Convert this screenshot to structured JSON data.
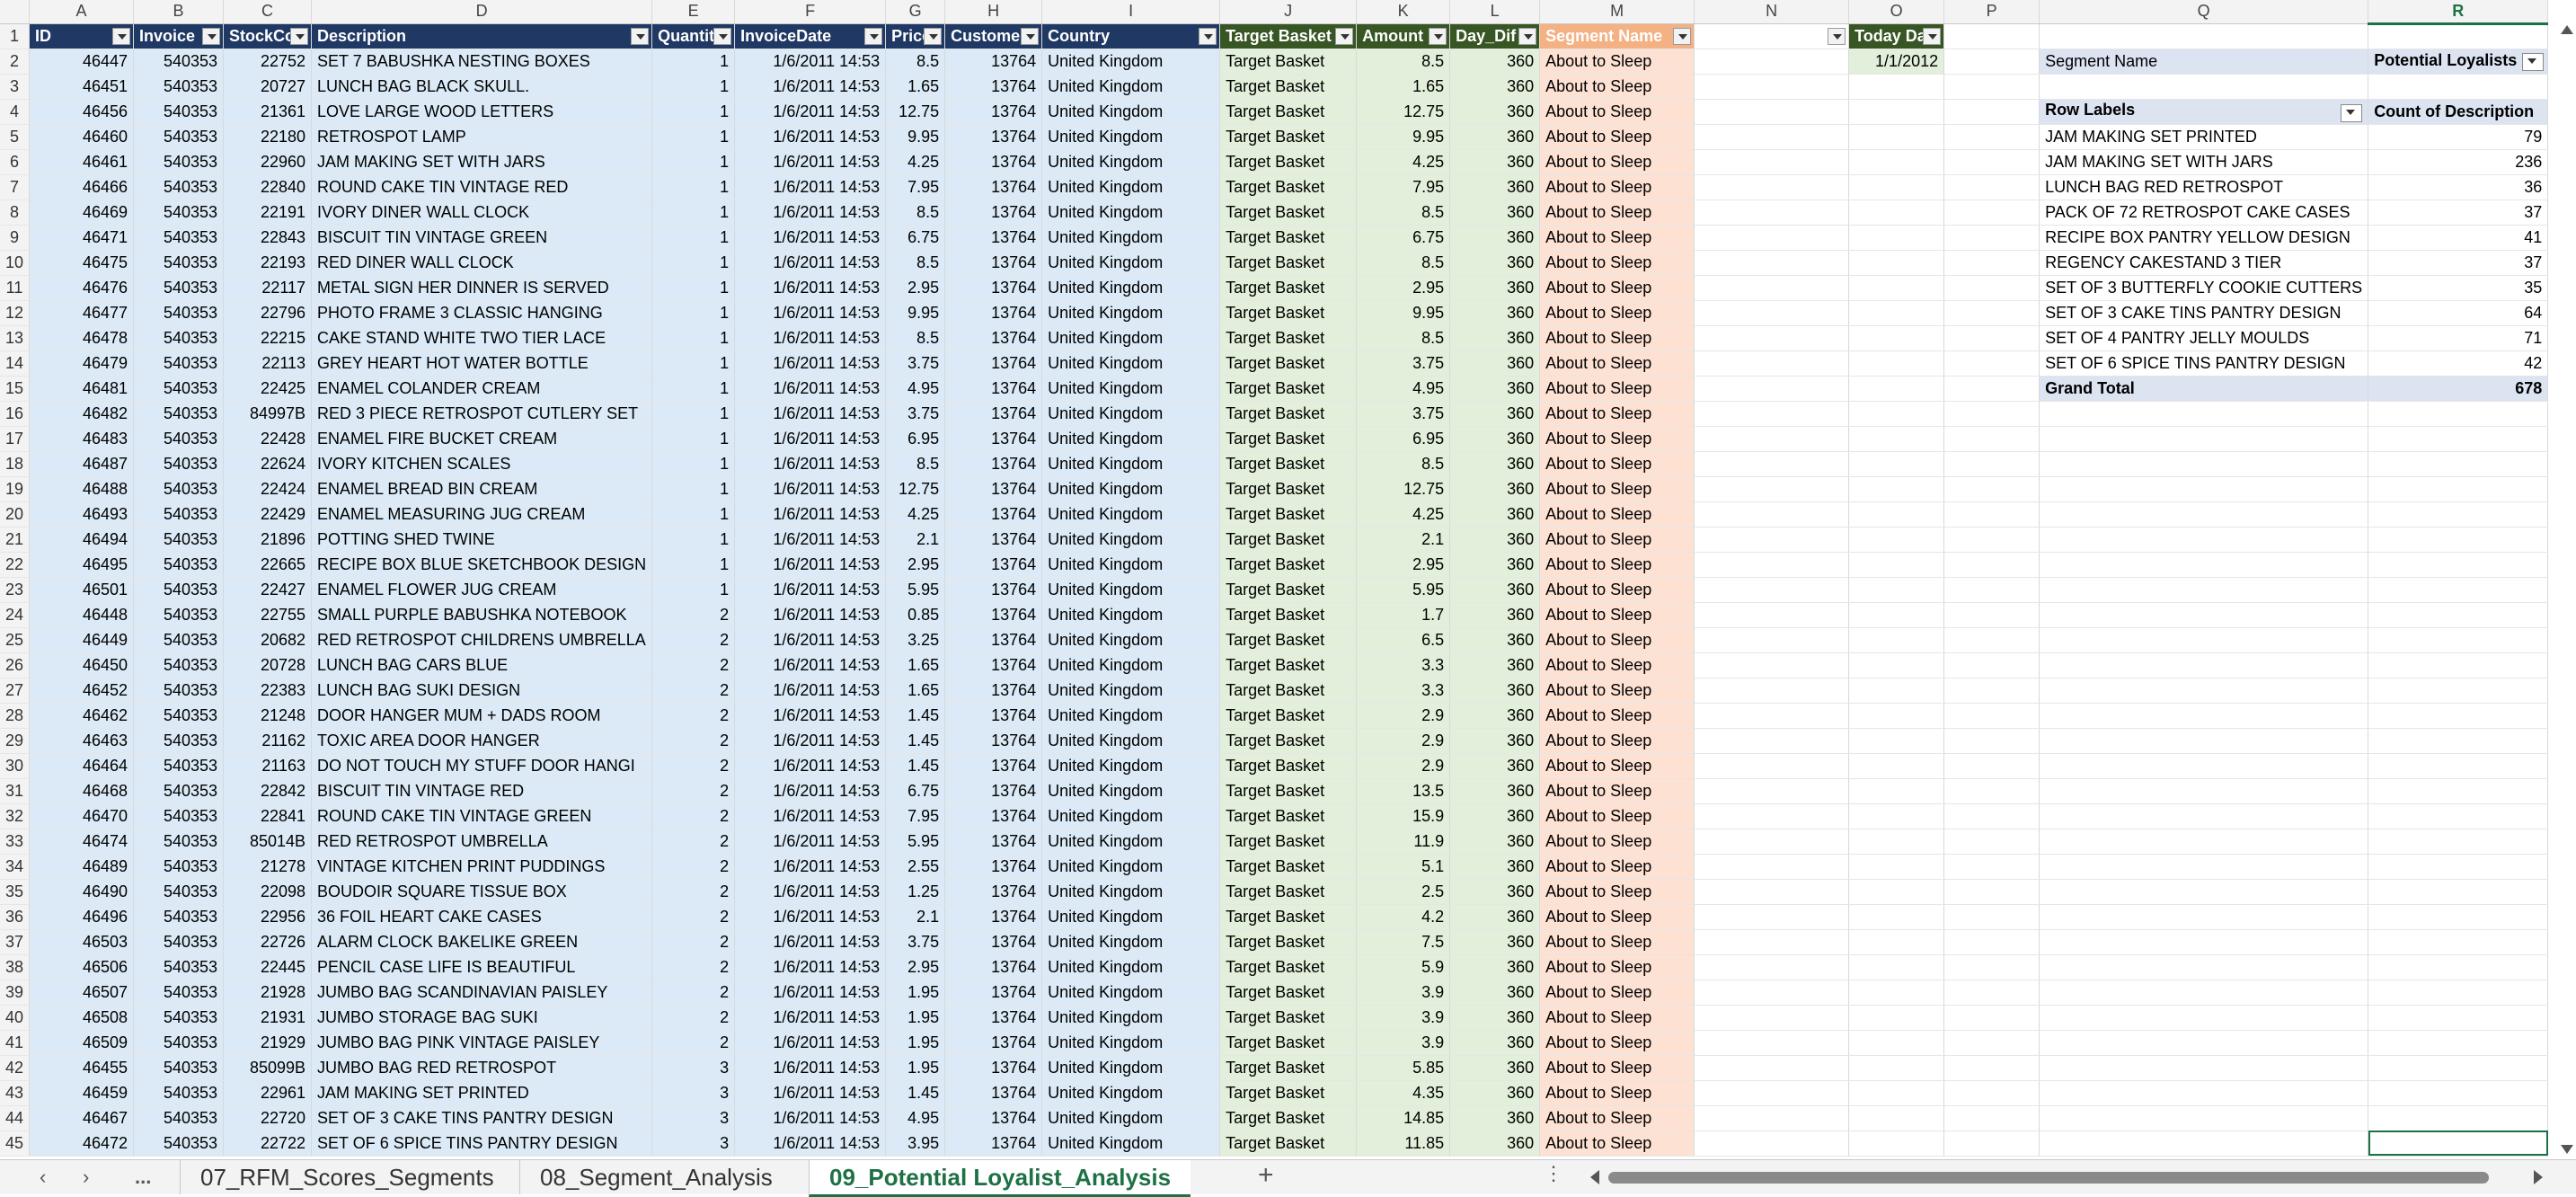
{
  "app": {
    "sheet_tabs": [
      "07_RFM_Scores_Segments",
      "08_Segment_Analysis",
      "09_Potential Loyalist_Analysis"
    ],
    "active_tab": "09_Potential Loyalist_Analysis",
    "more_tabs_label": "...",
    "add_sheet_label": "+",
    "selected_column": "R"
  },
  "column_letters": [
    "A",
    "B",
    "C",
    "D",
    "E",
    "F",
    "G",
    "H",
    "I",
    "J",
    "K",
    "L",
    "M",
    "N",
    "O",
    "P",
    "Q",
    "R"
  ],
  "headers": {
    "id": "ID",
    "invoice": "Invoice",
    "stockcode": "StockCo",
    "description": "Description",
    "quantity": "Quantit",
    "invoicedate": "InvoiceDate",
    "price": "Price",
    "customer": "Customer",
    "country": "Country",
    "target": "Target Basket",
    "amount": "Amount",
    "daydiff": "Day_Dif",
    "segment": "Segment Name",
    "today": "Today Da"
  },
  "today_value": "1/1/2012",
  "constants": {
    "invoice_date": "1/6/2011 14:53",
    "customer": "13764",
    "country": "United Kingdom",
    "target": "Target Basket",
    "day_diff": "360",
    "segment": "About to Sleep"
  },
  "rows": [
    [
      "46447",
      "540353",
      "22752",
      "SET 7 BABUSHKA NESTING BOXES",
      "1",
      "8.5",
      "8.5"
    ],
    [
      "46451",
      "540353",
      "20727",
      "LUNCH BAG  BLACK SKULL.",
      "1",
      "1.65",
      "1.65"
    ],
    [
      "46456",
      "540353",
      "21361",
      "LOVE LARGE WOOD LETTERS",
      "1",
      "12.75",
      "12.75"
    ],
    [
      "46460",
      "540353",
      "22180",
      "RETROSPOT LAMP",
      "1",
      "9.95",
      "9.95"
    ],
    [
      "46461",
      "540353",
      "22960",
      "JAM MAKING SET WITH JARS",
      "1",
      "4.25",
      "4.25"
    ],
    [
      "46466",
      "540353",
      "22840",
      "ROUND CAKE TIN VINTAGE RED",
      "1",
      "7.95",
      "7.95"
    ],
    [
      "46469",
      "540353",
      "22191",
      "IVORY DINER WALL CLOCK",
      "1",
      "8.5",
      "8.5"
    ],
    [
      "46471",
      "540353",
      "22843",
      "BISCUIT TIN VINTAGE GREEN",
      "1",
      "6.75",
      "6.75"
    ],
    [
      "46475",
      "540353",
      "22193",
      "RED DINER WALL CLOCK",
      "1",
      "8.5",
      "8.5"
    ],
    [
      "46476",
      "540353",
      "22117",
      "METAL SIGN HER DINNER IS SERVED",
      "1",
      "2.95",
      "2.95"
    ],
    [
      "46477",
      "540353",
      "22796",
      "PHOTO FRAME 3 CLASSIC HANGING",
      "1",
      "9.95",
      "9.95"
    ],
    [
      "46478",
      "540353",
      "22215",
      "CAKE STAND WHITE TWO TIER LACE",
      "1",
      "8.5",
      "8.5"
    ],
    [
      "46479",
      "540353",
      "22113",
      "GREY HEART HOT WATER BOTTLE",
      "1",
      "3.75",
      "3.75"
    ],
    [
      "46481",
      "540353",
      "22425",
      "ENAMEL COLANDER CREAM",
      "1",
      "4.95",
      "4.95"
    ],
    [
      "46482",
      "540353",
      "84997B",
      "RED 3 PIECE RETROSPOT CUTLERY SET",
      "1",
      "3.75",
      "3.75"
    ],
    [
      "46483",
      "540353",
      "22428",
      "ENAMEL FIRE BUCKET CREAM",
      "1",
      "6.95",
      "6.95"
    ],
    [
      "46487",
      "540353",
      "22624",
      "IVORY KITCHEN SCALES",
      "1",
      "8.5",
      "8.5"
    ],
    [
      "46488",
      "540353",
      "22424",
      "ENAMEL BREAD BIN CREAM",
      "1",
      "12.75",
      "12.75"
    ],
    [
      "46493",
      "540353",
      "22429",
      "ENAMEL MEASURING JUG CREAM",
      "1",
      "4.25",
      "4.25"
    ],
    [
      "46494",
      "540353",
      "21896",
      "POTTING SHED TWINE",
      "1",
      "2.1",
      "2.1"
    ],
    [
      "46495",
      "540353",
      "22665",
      "RECIPE BOX BLUE SKETCHBOOK DESIGN",
      "1",
      "2.95",
      "2.95"
    ],
    [
      "46501",
      "540353",
      "22427",
      "ENAMEL FLOWER JUG CREAM",
      "1",
      "5.95",
      "5.95"
    ],
    [
      "46448",
      "540353",
      "22755",
      "SMALL PURPLE BABUSHKA NOTEBOOK",
      "2",
      "0.85",
      "1.7"
    ],
    [
      "46449",
      "540353",
      "20682",
      "RED RETROSPOT CHILDRENS UMBRELLA",
      "2",
      "3.25",
      "6.5"
    ],
    [
      "46450",
      "540353",
      "20728",
      "LUNCH BAG CARS BLUE",
      "2",
      "1.65",
      "3.3"
    ],
    [
      "46452",
      "540353",
      "22383",
      "LUNCH BAG SUKI  DESIGN",
      "2",
      "1.65",
      "3.3"
    ],
    [
      "46462",
      "540353",
      "21248",
      "DOOR HANGER  MUM + DADS ROOM",
      "2",
      "1.45",
      "2.9"
    ],
    [
      "46463",
      "540353",
      "21162",
      "TOXIC AREA  DOOR HANGER",
      "2",
      "1.45",
      "2.9"
    ],
    [
      "46464",
      "540353",
      "21163",
      "DO NOT TOUCH MY STUFF DOOR HANGI",
      "2",
      "1.45",
      "2.9"
    ],
    [
      "46468",
      "540353",
      "22842",
      "BISCUIT TIN VINTAGE RED",
      "2",
      "6.75",
      "13.5"
    ],
    [
      "46470",
      "540353",
      "22841",
      "ROUND CAKE TIN VINTAGE GREEN",
      "2",
      "7.95",
      "15.9"
    ],
    [
      "46474",
      "540353",
      "85014B",
      "RED RETROSPOT UMBRELLA",
      "2",
      "5.95",
      "11.9"
    ],
    [
      "46489",
      "540353",
      "21278",
      "VINTAGE KITCHEN PRINT PUDDINGS",
      "2",
      "2.55",
      "5.1"
    ],
    [
      "46490",
      "540353",
      "22098",
      "BOUDOIR SQUARE TISSUE BOX",
      "2",
      "1.25",
      "2.5"
    ],
    [
      "46496",
      "540353",
      "22956",
      "36 FOIL HEART CAKE CASES",
      "2",
      "2.1",
      "4.2"
    ],
    [
      "46503",
      "540353",
      "22726",
      "ALARM CLOCK BAKELIKE GREEN",
      "2",
      "3.75",
      "7.5"
    ],
    [
      "46506",
      "540353",
      "22445",
      "PENCIL CASE LIFE IS BEAUTIFUL",
      "2",
      "2.95",
      "5.9"
    ],
    [
      "46507",
      "540353",
      "21928",
      "JUMBO BAG SCANDINAVIAN PAISLEY",
      "2",
      "1.95",
      "3.9"
    ],
    [
      "46508",
      "540353",
      "21931",
      "JUMBO STORAGE BAG SUKI",
      "2",
      "1.95",
      "3.9"
    ],
    [
      "46509",
      "540353",
      "21929",
      "JUMBO BAG PINK VINTAGE PAISLEY",
      "2",
      "1.95",
      "3.9"
    ],
    [
      "46455",
      "540353",
      "85099B",
      "JUMBO BAG RED RETROSPOT",
      "3",
      "1.95",
      "5.85"
    ],
    [
      "46459",
      "540353",
      "22961",
      "JAM MAKING SET PRINTED",
      "3",
      "1.45",
      "4.35"
    ],
    [
      "46467",
      "540353",
      "22720",
      "SET OF 3 CAKE TINS PANTRY DESIGN",
      "3",
      "4.95",
      "14.85"
    ],
    [
      "46472",
      "540353",
      "22722",
      "SET OF 6 SPICE TINS PANTRY DESIGN",
      "3",
      "3.95",
      "11.85"
    ]
  ],
  "pivot": {
    "filter_label": "Segment Name",
    "filter_value": "Potential Loyalists",
    "row_labels_header": "Row Labels",
    "value_header": "Count of Description",
    "rows": [
      [
        "JAM MAKING SET PRINTED",
        "79"
      ],
      [
        "JAM MAKING SET WITH JARS",
        "236"
      ],
      [
        "LUNCH BAG RED RETROSPOT",
        "36"
      ],
      [
        "PACK OF 72 RETROSPOT CAKE CASES",
        "37"
      ],
      [
        "RECIPE BOX PANTRY YELLOW DESIGN",
        "41"
      ],
      [
        "REGENCY CAKESTAND 3 TIER",
        "37"
      ],
      [
        "SET OF 3 BUTTERFLY COOKIE CUTTERS",
        "35"
      ],
      [
        "SET OF 3 CAKE TINS PANTRY DESIGN",
        "64"
      ],
      [
        "SET OF 4 PANTRY JELLY MOULDS",
        "71"
      ],
      [
        "SET OF 6 SPICE TINS PANTRY DESIGN",
        "42"
      ]
    ],
    "grand_total_label": "Grand Total",
    "grand_total_value": "678"
  },
  "colors": {
    "header_navy": "#1f3864",
    "header_green": "#375623",
    "header_peach": "#f4b183",
    "fill_blue": "#dbeaf6",
    "fill_green": "#e2efda",
    "fill_peach": "#fde1d3",
    "pivot_band": "#dce3f1",
    "accent": "#1e7145"
  },
  "icons": [
    "filter-dropdown-icon",
    "sheet-nav-prev-icon",
    "sheet-nav-next-icon",
    "add-sheet-icon",
    "scroll-left-icon",
    "scroll-right-icon"
  ]
}
